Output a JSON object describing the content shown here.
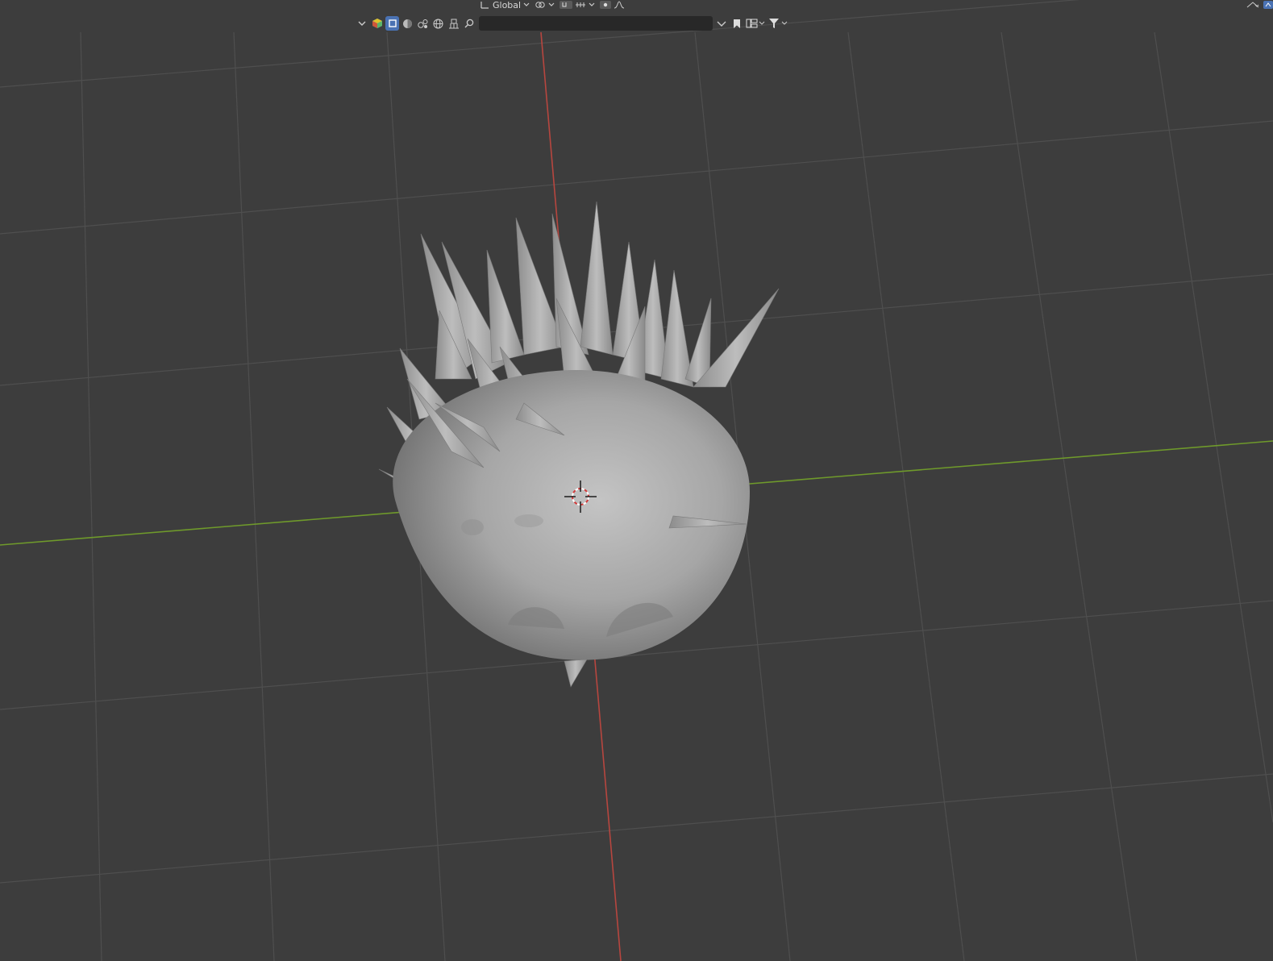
{
  "header": {
    "transform_orientation": "Global"
  },
  "outliner_toolbar": {
    "search": {
      "value": "",
      "placeholder": ""
    },
    "icons": [
      "collapse-chevron-icon",
      "scene-collection-icon",
      "object-icon",
      "material-icon",
      "camera-data-icon",
      "world-icon",
      "render-layer-icon",
      "search-icon",
      "chevron-down-icon",
      "bookmark-icon",
      "layout-icon",
      "filter-icon"
    ]
  },
  "viewport": {
    "background_color": "#3d3d3d",
    "grid_color": "#4f4f4f",
    "x_axis_color": "#b7463f",
    "y_axis_color": "#6f9a2b",
    "model_color": "#a3a3a3",
    "icons": [
      "3d-cursor-icon"
    ]
  }
}
